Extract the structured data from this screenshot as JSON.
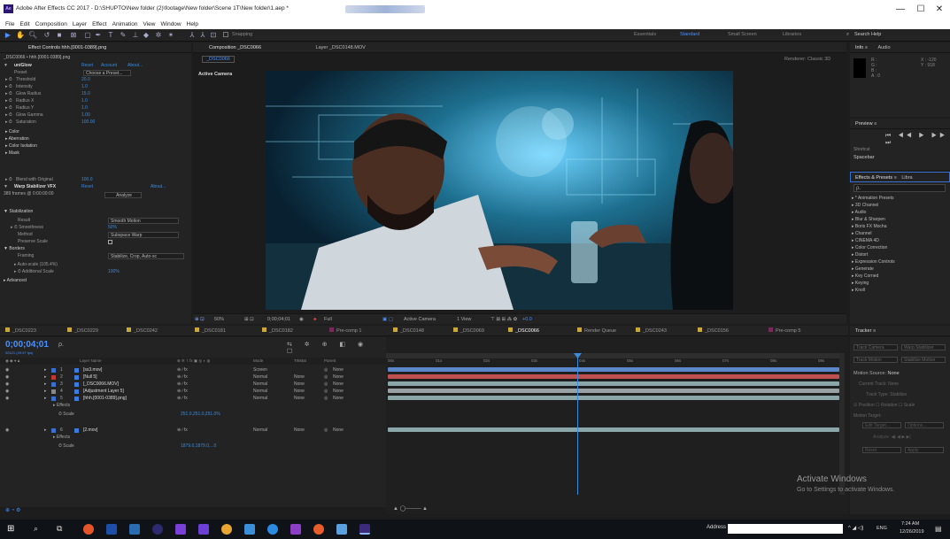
{
  "window": {
    "title": "Adobe After Effects CC 2017 - D:\\SHUPTO\\New folder (2)\\footage\\New folder\\Scene 1T\\New folder\\1.aep *",
    "app_icon": "Ae",
    "minimize": "—",
    "maximize": "☐",
    "close": "✕"
  },
  "menu": [
    "File",
    "Edit",
    "Composition",
    "Layer",
    "Effect",
    "Animation",
    "View",
    "Window",
    "Help"
  ],
  "toolbar": {
    "snapping": "Snapping",
    "workspaces": [
      "Essentials",
      "Standard",
      "Small Screen",
      "Libraries"
    ],
    "active_workspace": "Standard",
    "search": "Search Help"
  },
  "effect_controls": {
    "tab": "Effect Controls hhh.[0001-0389].png",
    "breadcrumb": "_DSC0066 • hhh.[0001-0389].png",
    "fx1": {
      "name": "uniGlow",
      "reset": "Reset",
      "account": "Account",
      "about": "About...",
      "preset_label": "Preset",
      "preset_value": "Choose a Preset...",
      "params": [
        {
          "name": "Threshold",
          "value": "20.0"
        },
        {
          "name": "Intensity",
          "value": "1.0"
        },
        {
          "name": "Glow Radius",
          "value": "15.0"
        },
        {
          "name": "Radius X",
          "value": "1.0"
        },
        {
          "name": "Radius Y",
          "value": "1.0"
        },
        {
          "name": "Glow Gamma",
          "value": "1.00"
        },
        {
          "name": "Saturation",
          "value": "100.00"
        }
      ],
      "groups": [
        "Color",
        "Aberration",
        "Color Isolation",
        "Mask"
      ],
      "blend_label": "Blend with Original",
      "blend_value": "100.0"
    },
    "fx2": {
      "name": "Warp Stabilizer VFX",
      "reset": "Reset",
      "about": "About...",
      "frames": "389 frames @ 0:00:00:00",
      "analyze": "Analyze",
      "stabilization": "Stabilization",
      "result_label": "Result",
      "result_value": "Smooth Motion",
      "smoothness_label": "Smoothness",
      "smoothness_value": "50%",
      "method_label": "Method",
      "method_value": "Subspace Warp",
      "preserve_label": "Preserve Scale",
      "borders": "Borders",
      "framing_label": "Framing",
      "framing_value": "Stabilize, Crop, Auto-sc",
      "autoscale": "Auto-scale (105.4%)",
      "addscale_label": "Additional Scale",
      "addscale_value": "100%",
      "advanced": "Advanced"
    }
  },
  "composition": {
    "tab": "Composition _DSC0066",
    "layer_tab": "Layer _DSC0148.MOV",
    "subtab": "_DSC0066",
    "renderer": "Renderer:",
    "renderer_value": "Classic 3D",
    "active_camera": "Active Camera",
    "footer": {
      "zoom": "50%",
      "time": "0;00;04;01",
      "resolution": "Full",
      "camera": "Active Camera",
      "view": "1 View",
      "exposure": "+0.0"
    }
  },
  "info": {
    "tabs": [
      "Info",
      "Audio"
    ],
    "r": "R :",
    "g": "G :",
    "b": "B :",
    "a": "A : 0",
    "x": "X : -120",
    "y": "Y : 918"
  },
  "preview": {
    "title": "Preview",
    "shortcut_label": "Shortcut",
    "shortcut_value": "Spacebar"
  },
  "effects_presets": {
    "title": "Effects & Presets",
    "other_tab": "Libra",
    "items": [
      "* Animation Presets",
      "3D Channel",
      "Audio",
      "Blur & Sharpen",
      "Boris FX Mocha",
      "Channel",
      "CINEMA 4D",
      "Color Correction",
      "Distort",
      "Expression Controls",
      "Generate",
      "Key Corned",
      "Keying",
      "Knoll"
    ]
  },
  "timeline_tabs": [
    "_DSC0223",
    "_DSC0229",
    "_DSC0242",
    "_DSC0181",
    "_DSC0182",
    "Pre-comp 1",
    "_DSC0148",
    "_DSC0069",
    "_DSC0066",
    "Render Queue",
    "_DSC0243",
    "_DSC0156",
    "Pre-comp 5"
  ],
  "active_timeline_tab": "_DSC0066",
  "timeline": {
    "timecode": "0;00;04;01",
    "timecode_sub": "00121 (29.97 fps)",
    "search_placeholder": "ρ.",
    "col_layer": "Layer Name",
    "col_mode": "Mode",
    "col_trkmat": "TrkMat",
    "col_parent": "Parent",
    "layers": [
      {
        "num": "1",
        "name": "[ss3.mov]",
        "mode": "Screen",
        "trk": "",
        "parent": "None",
        "color": "#3b6fd1"
      },
      {
        "num": "2",
        "name": "[Null 5]",
        "mode": "Normal",
        "trk": "None",
        "parent": "None",
        "color": "#c0392b"
      },
      {
        "num": "3",
        "name": "[_DSC0066.MOV]",
        "mode": "Normal",
        "trk": "None",
        "parent": "None",
        "color": "#3b6fd1"
      },
      {
        "num": "4",
        "name": "[Adjustment Layer 5]",
        "mode": "Normal",
        "trk": "None",
        "parent": "None",
        "color": "#888"
      },
      {
        "num": "5",
        "name": "[hhh.[0001-0389].png]",
        "mode": "Normal",
        "trk": "None",
        "parent": "None",
        "color": "#3b6fd1"
      },
      {
        "num": "6",
        "name": "[2.mov]",
        "mode": "Normal",
        "trk": "None",
        "parent": "None",
        "color": "#3b6fd1"
      }
    ],
    "effects_label": "Effects",
    "scale_label": "Scale",
    "scale5": "251.0,251.0,251.0%",
    "scale6": "1879.0,1879.0,...0",
    "ruler": [
      "00s",
      "01s",
      "02s",
      "03s",
      "04s",
      "05s",
      "06s",
      "07s",
      "08s",
      "09s"
    ]
  },
  "tracker": {
    "title": "Tracker",
    "buttons": [
      "Track Camera",
      "Warp Stabilizer",
      "Track Motion",
      "Stabilize Motion"
    ],
    "motion_source_label": "Motion Source:",
    "motion_source_value": "None",
    "current_track": "Current Track: None",
    "track_type": "Track Type: Stabilize",
    "opts": [
      "Position",
      "Rotation",
      "Scale"
    ],
    "motion_target": "Motion Target:",
    "edit_target": "Edit Target...",
    "options": "Options...",
    "analyze": "Analyze:",
    "reset": "Reset",
    "apply": "Apply"
  },
  "watermark": {
    "line1": "Activate Windows",
    "line2": "Go to Settings to activate Windows."
  },
  "taskbar": {
    "address": "Address",
    "lang": "ENG",
    "time": "7:24 AM",
    "date": "12/26/2019"
  }
}
